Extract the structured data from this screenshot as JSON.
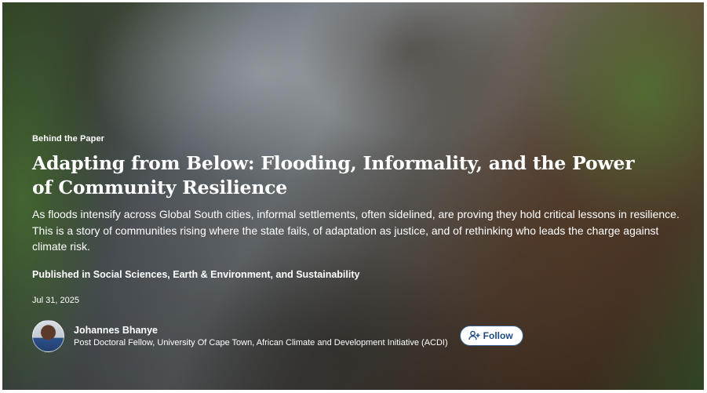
{
  "article": {
    "category": "Behind the Paper",
    "title": "Adapting from Below: Flooding, Informality, and the Power of Community Resilience",
    "summary": "As floods intensify across Global South cities, informal settlements, often sidelined, are proving they hold critical lessons in resilience. This is a story of communities rising where the state fails, of adaptation as justice, and of rethinking who leads the charge against climate risk.",
    "published_in": "Published in Social Sciences, Earth & Environment, and Sustainability",
    "date": "Jul 31, 2025"
  },
  "author": {
    "name": "Johannes Bhanye",
    "role": "Post Doctoral Fellow, University Of Cape Town, African Climate and Development Initiative (ACDI)",
    "avatar_icon": "person-photo"
  },
  "follow_button": {
    "label": "Follow",
    "icon": "add-person-icon",
    "border_color": "#3a5f8f",
    "text_color": "#1d4a80"
  }
}
